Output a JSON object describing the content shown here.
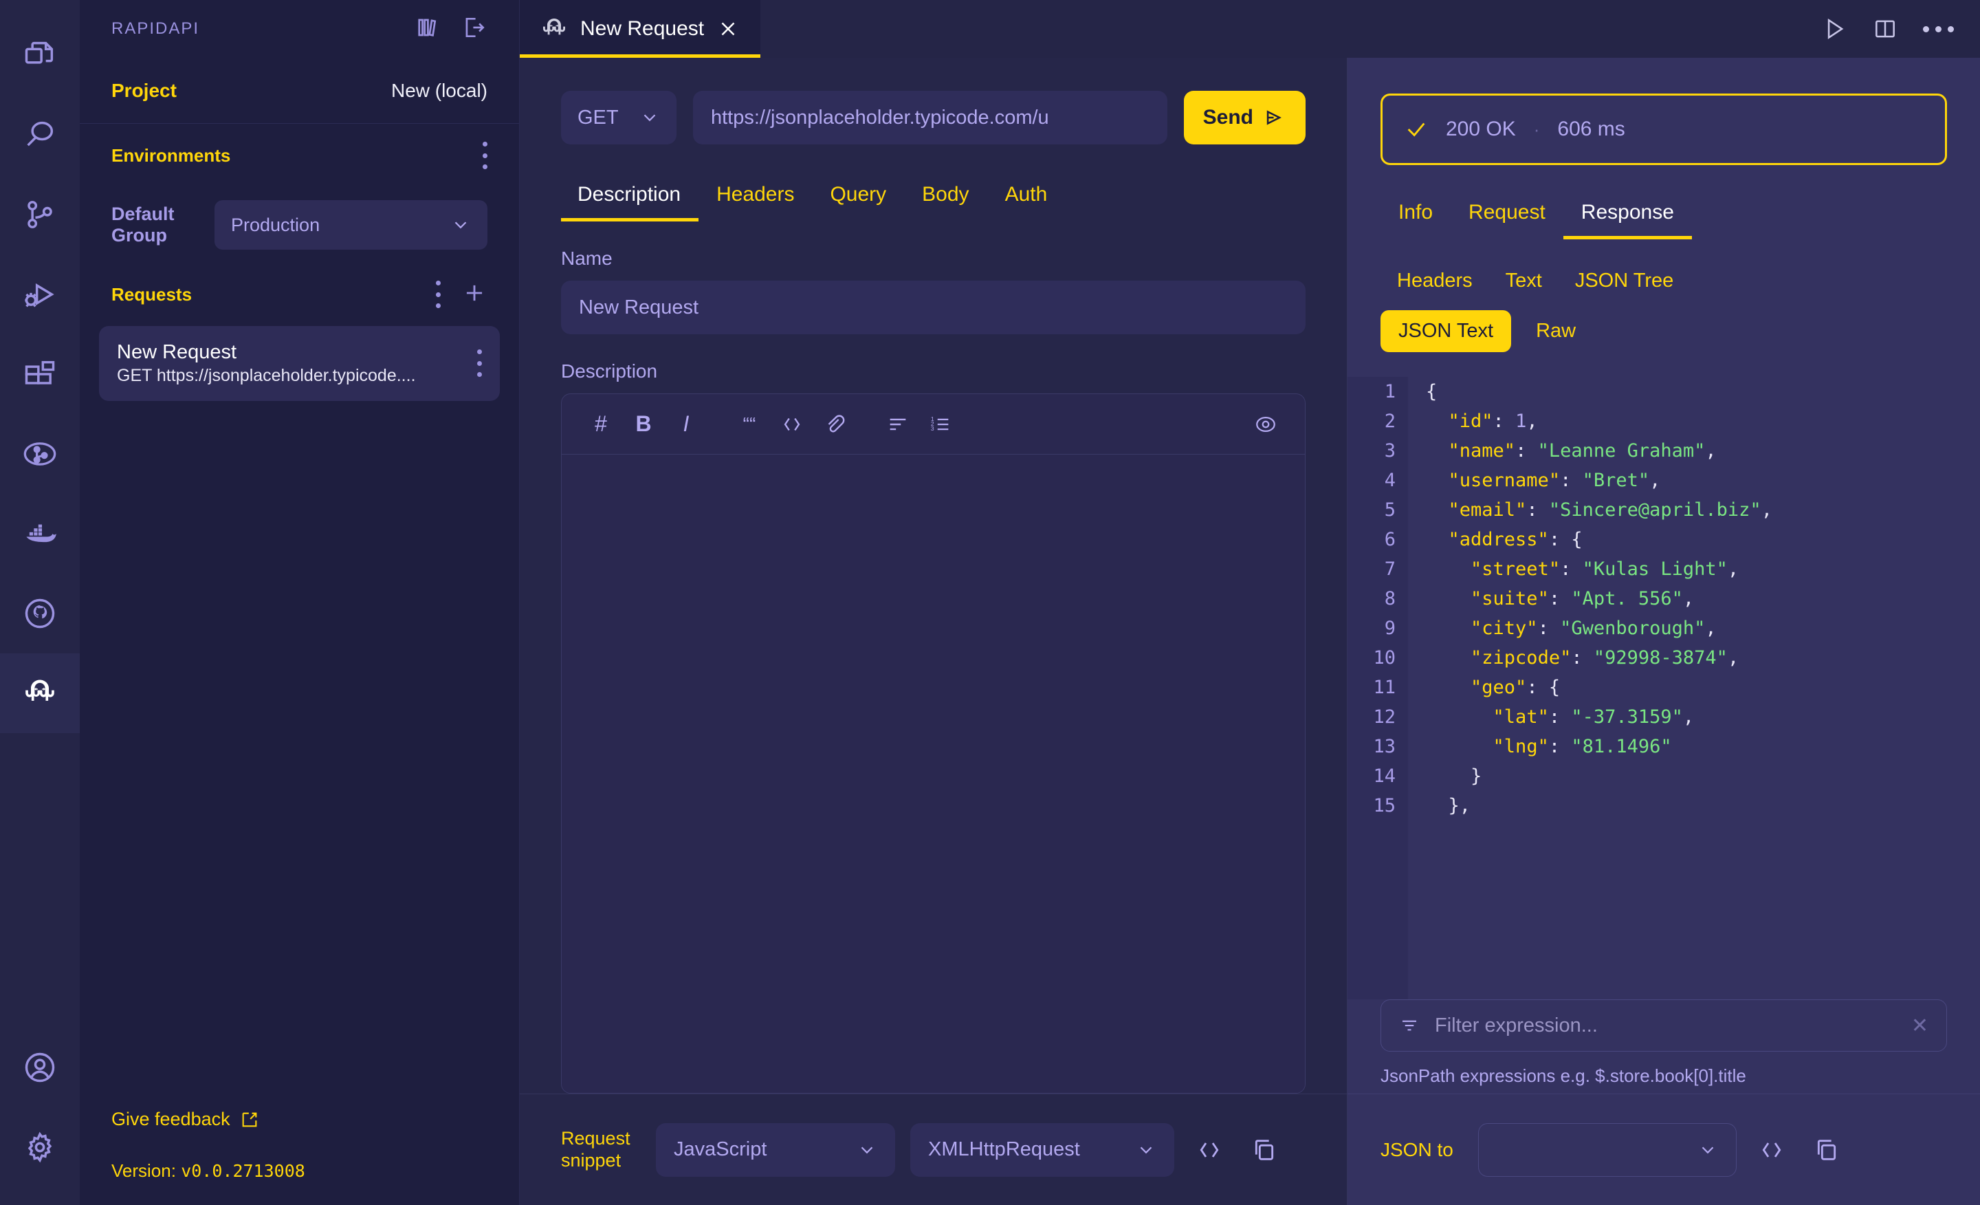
{
  "activity_bar": {
    "items": [
      {
        "name": "explorer-icon",
        "label": "Explorer"
      },
      {
        "name": "search-icon",
        "label": "Search"
      },
      {
        "name": "source-control-icon",
        "label": "Source Control"
      },
      {
        "name": "run-debug-icon",
        "label": "Run and Debug"
      },
      {
        "name": "extensions-icon",
        "label": "Extensions"
      },
      {
        "name": "git-graph-icon",
        "label": "Git Graph"
      },
      {
        "name": "docker-icon",
        "label": "Docker"
      },
      {
        "name": "github-icon",
        "label": "GitHub"
      },
      {
        "name": "rapidapi-octopus-icon",
        "label": "RapidAPI Client",
        "active": true
      }
    ],
    "bottom_items": [
      {
        "name": "account-icon",
        "label": "Accounts"
      },
      {
        "name": "settings-gear-icon",
        "label": "Manage"
      }
    ]
  },
  "sidebar": {
    "title": "RAPIDAPI",
    "header_icons": [
      {
        "name": "library-icon",
        "label": "Library"
      },
      {
        "name": "open-external-icon",
        "label": "Open in new window"
      }
    ],
    "project": {
      "label": "Project",
      "value": "New (local)"
    },
    "environments": {
      "title": "Environments",
      "menu_icon": "more-options-icon",
      "group_label": "Default Group",
      "selected": "Production"
    },
    "requests": {
      "title": "Requests",
      "menu_icon": "more-options-icon",
      "add_icon": "plus-icon",
      "items": [
        {
          "name": "New Request",
          "subtitle": "GET https://jsonplaceholder.typicode...."
        }
      ]
    },
    "footer": {
      "feedback_label": "Give feedback",
      "feedback_icon": "external-link-icon",
      "version_label": "Version:",
      "version_value": "v0.0.2713008"
    }
  },
  "tabbar": {
    "tabs": [
      {
        "label": "New Request",
        "icon": "rapidapi-octopus-icon",
        "close_icon": "close-icon",
        "active": true
      }
    ],
    "right_icons": [
      {
        "name": "run-icon",
        "label": "Run"
      },
      {
        "name": "split-editor-icon",
        "label": "Split Editor"
      },
      {
        "name": "more-actions-icon",
        "label": "More Actions"
      }
    ]
  },
  "request": {
    "method": "GET",
    "method_chevron": "chevron-down-icon",
    "url": "https://jsonplaceholder.typicode.com/u",
    "send_label": "Send",
    "send_icon": "send-icon",
    "tabs": [
      {
        "label": "Description",
        "active": true
      },
      {
        "label": "Headers",
        "active": false
      },
      {
        "label": "Query",
        "active": false
      },
      {
        "label": "Body",
        "active": false
      },
      {
        "label": "Auth",
        "active": false
      }
    ],
    "name_label": "Name",
    "name_value": "New Request",
    "description_label": "Description",
    "description_value": "",
    "markdown_toolbar": [
      {
        "name": "heading-icon",
        "glyph": "#"
      },
      {
        "name": "bold-icon",
        "glyph": "B"
      },
      {
        "name": "italic-icon",
        "glyph": "I"
      },
      {
        "name": "quote-icon",
        "glyph": "66"
      },
      {
        "name": "code-icon",
        "glyph": "</>"
      },
      {
        "name": "link-icon",
        "glyph": "link"
      },
      {
        "name": "bullet-list-icon",
        "glyph": "list"
      },
      {
        "name": "numbered-list-icon",
        "glyph": "ordered-list"
      },
      {
        "name": "preview-eye-icon",
        "glyph": "eye"
      }
    ],
    "snippet": {
      "label": "Request snippet",
      "language": "JavaScript",
      "library": "XMLHttpRequest",
      "code_icon": "code-icon",
      "copy_icon": "copy-icon"
    }
  },
  "response": {
    "status": {
      "check_icon": "check-icon",
      "code": "200 OK",
      "separator": "·",
      "time": "606 ms"
    },
    "tabs": [
      {
        "label": "Info",
        "active": false
      },
      {
        "label": "Request",
        "active": false
      },
      {
        "label": "Response",
        "active": true
      }
    ],
    "subtabs": [
      {
        "label": "Headers",
        "active": false
      },
      {
        "label": "Text",
        "active": false
      },
      {
        "label": "JSON Tree",
        "active": false
      }
    ],
    "formats": [
      {
        "label": "JSON Text",
        "active": true
      },
      {
        "label": "Raw",
        "active": false
      }
    ],
    "body_lines": [
      {
        "n": "1",
        "tokens": [
          {
            "t": "{",
            "c": "p"
          }
        ]
      },
      {
        "n": "2",
        "tokens": [
          {
            "t": "  ",
            "c": "p"
          },
          {
            "t": "\"id\"",
            "c": "k"
          },
          {
            "t": ": ",
            "c": "p"
          },
          {
            "t": "1",
            "c": "n"
          },
          {
            "t": ",",
            "c": "p"
          }
        ]
      },
      {
        "n": "3",
        "tokens": [
          {
            "t": "  ",
            "c": "p"
          },
          {
            "t": "\"name\"",
            "c": "k"
          },
          {
            "t": ": ",
            "c": "p"
          },
          {
            "t": "\"Leanne Graham\"",
            "c": "s"
          },
          {
            "t": ",",
            "c": "p"
          }
        ]
      },
      {
        "n": "4",
        "tokens": [
          {
            "t": "  ",
            "c": "p"
          },
          {
            "t": "\"username\"",
            "c": "k"
          },
          {
            "t": ": ",
            "c": "p"
          },
          {
            "t": "\"Bret\"",
            "c": "s"
          },
          {
            "t": ",",
            "c": "p"
          }
        ]
      },
      {
        "n": "5",
        "tokens": [
          {
            "t": "  ",
            "c": "p"
          },
          {
            "t": "\"email\"",
            "c": "k"
          },
          {
            "t": ": ",
            "c": "p"
          },
          {
            "t": "\"Sincere@april.biz\"",
            "c": "s"
          },
          {
            "t": ",",
            "c": "p"
          }
        ]
      },
      {
        "n": "6",
        "tokens": [
          {
            "t": "  ",
            "c": "p"
          },
          {
            "t": "\"address\"",
            "c": "k"
          },
          {
            "t": ": ",
            "c": "p"
          },
          {
            "t": "{",
            "c": "p"
          }
        ]
      },
      {
        "n": "7",
        "tokens": [
          {
            "t": "    ",
            "c": "p"
          },
          {
            "t": "\"street\"",
            "c": "k"
          },
          {
            "t": ": ",
            "c": "p"
          },
          {
            "t": "\"Kulas Light\"",
            "c": "s"
          },
          {
            "t": ",",
            "c": "p"
          }
        ]
      },
      {
        "n": "8",
        "tokens": [
          {
            "t": "    ",
            "c": "p"
          },
          {
            "t": "\"suite\"",
            "c": "k"
          },
          {
            "t": ": ",
            "c": "p"
          },
          {
            "t": "\"Apt. 556\"",
            "c": "s"
          },
          {
            "t": ",",
            "c": "p"
          }
        ]
      },
      {
        "n": "9",
        "tokens": [
          {
            "t": "    ",
            "c": "p"
          },
          {
            "t": "\"city\"",
            "c": "k"
          },
          {
            "t": ": ",
            "c": "p"
          },
          {
            "t": "\"Gwenborough\"",
            "c": "s"
          },
          {
            "t": ",",
            "c": "p"
          }
        ]
      },
      {
        "n": "10",
        "tokens": [
          {
            "t": "    ",
            "c": "p"
          },
          {
            "t": "\"zipcode\"",
            "c": "k"
          },
          {
            "t": ": ",
            "c": "p"
          },
          {
            "t": "\"92998-3874\"",
            "c": "s"
          },
          {
            "t": ",",
            "c": "p"
          }
        ]
      },
      {
        "n": "11",
        "tokens": [
          {
            "t": "    ",
            "c": "p"
          },
          {
            "t": "\"geo\"",
            "c": "k"
          },
          {
            "t": ": ",
            "c": "p"
          },
          {
            "t": "{",
            "c": "p"
          }
        ]
      },
      {
        "n": "12",
        "tokens": [
          {
            "t": "      ",
            "c": "p"
          },
          {
            "t": "\"lat\"",
            "c": "k"
          },
          {
            "t": ": ",
            "c": "p"
          },
          {
            "t": "\"-37.3159\"",
            "c": "s"
          },
          {
            "t": ",",
            "c": "p"
          }
        ]
      },
      {
        "n": "13",
        "tokens": [
          {
            "t": "      ",
            "c": "p"
          },
          {
            "t": "\"lng\"",
            "c": "k"
          },
          {
            "t": ": ",
            "c": "p"
          },
          {
            "t": "\"81.1496\"",
            "c": "s"
          }
        ]
      },
      {
        "n": "14",
        "tokens": [
          {
            "t": "    }",
            "c": "p"
          }
        ]
      },
      {
        "n": "15",
        "tokens": [
          {
            "t": "  },",
            "c": "p"
          }
        ]
      }
    ],
    "filter": {
      "icon": "filter-icon",
      "placeholder": "Filter expression...",
      "value": "",
      "clear_icon": "close-icon",
      "help": "JsonPath expressions e.g. $.store.book[0].title"
    },
    "json_to": {
      "label": "JSON to",
      "selected": "",
      "chevron": "chevron-down-icon",
      "code_icon": "code-icon",
      "copy_icon": "copy-icon"
    }
  },
  "colors": {
    "accent_yellow": "#ffd60a",
    "panel_bg": "#1e1e3f",
    "editor_bg": "#262649",
    "response_bg": "#343260",
    "purple_text": "#b3a9f0",
    "json_key": "#ffd60a",
    "json_string": "#7ae582"
  }
}
